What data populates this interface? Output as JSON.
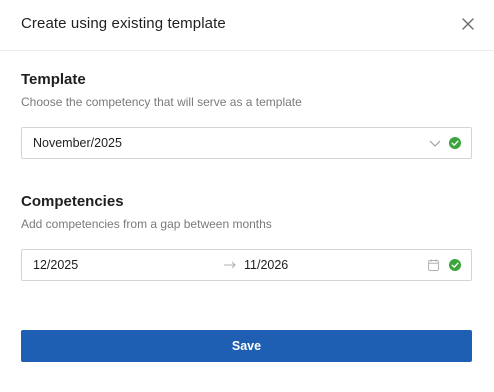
{
  "dialog": {
    "title": "Create using existing template"
  },
  "template_section": {
    "title": "Template",
    "description": "Choose the competency that will serve as a template",
    "select_value": "November/2025"
  },
  "competencies_section": {
    "title": "Competencies",
    "description": "Add competencies from a gap between months",
    "range_start": "12/2025",
    "range_end": "11/2026"
  },
  "footer": {
    "save_label": "Save"
  },
  "colors": {
    "primary": "#1e5fb3",
    "success": "#3aa53a"
  },
  "icons": {
    "close": "close-icon",
    "chevron": "chevron-down-icon",
    "valid": "check-circle-icon",
    "arrow": "arrow-right-icon",
    "calendar": "calendar-icon"
  }
}
